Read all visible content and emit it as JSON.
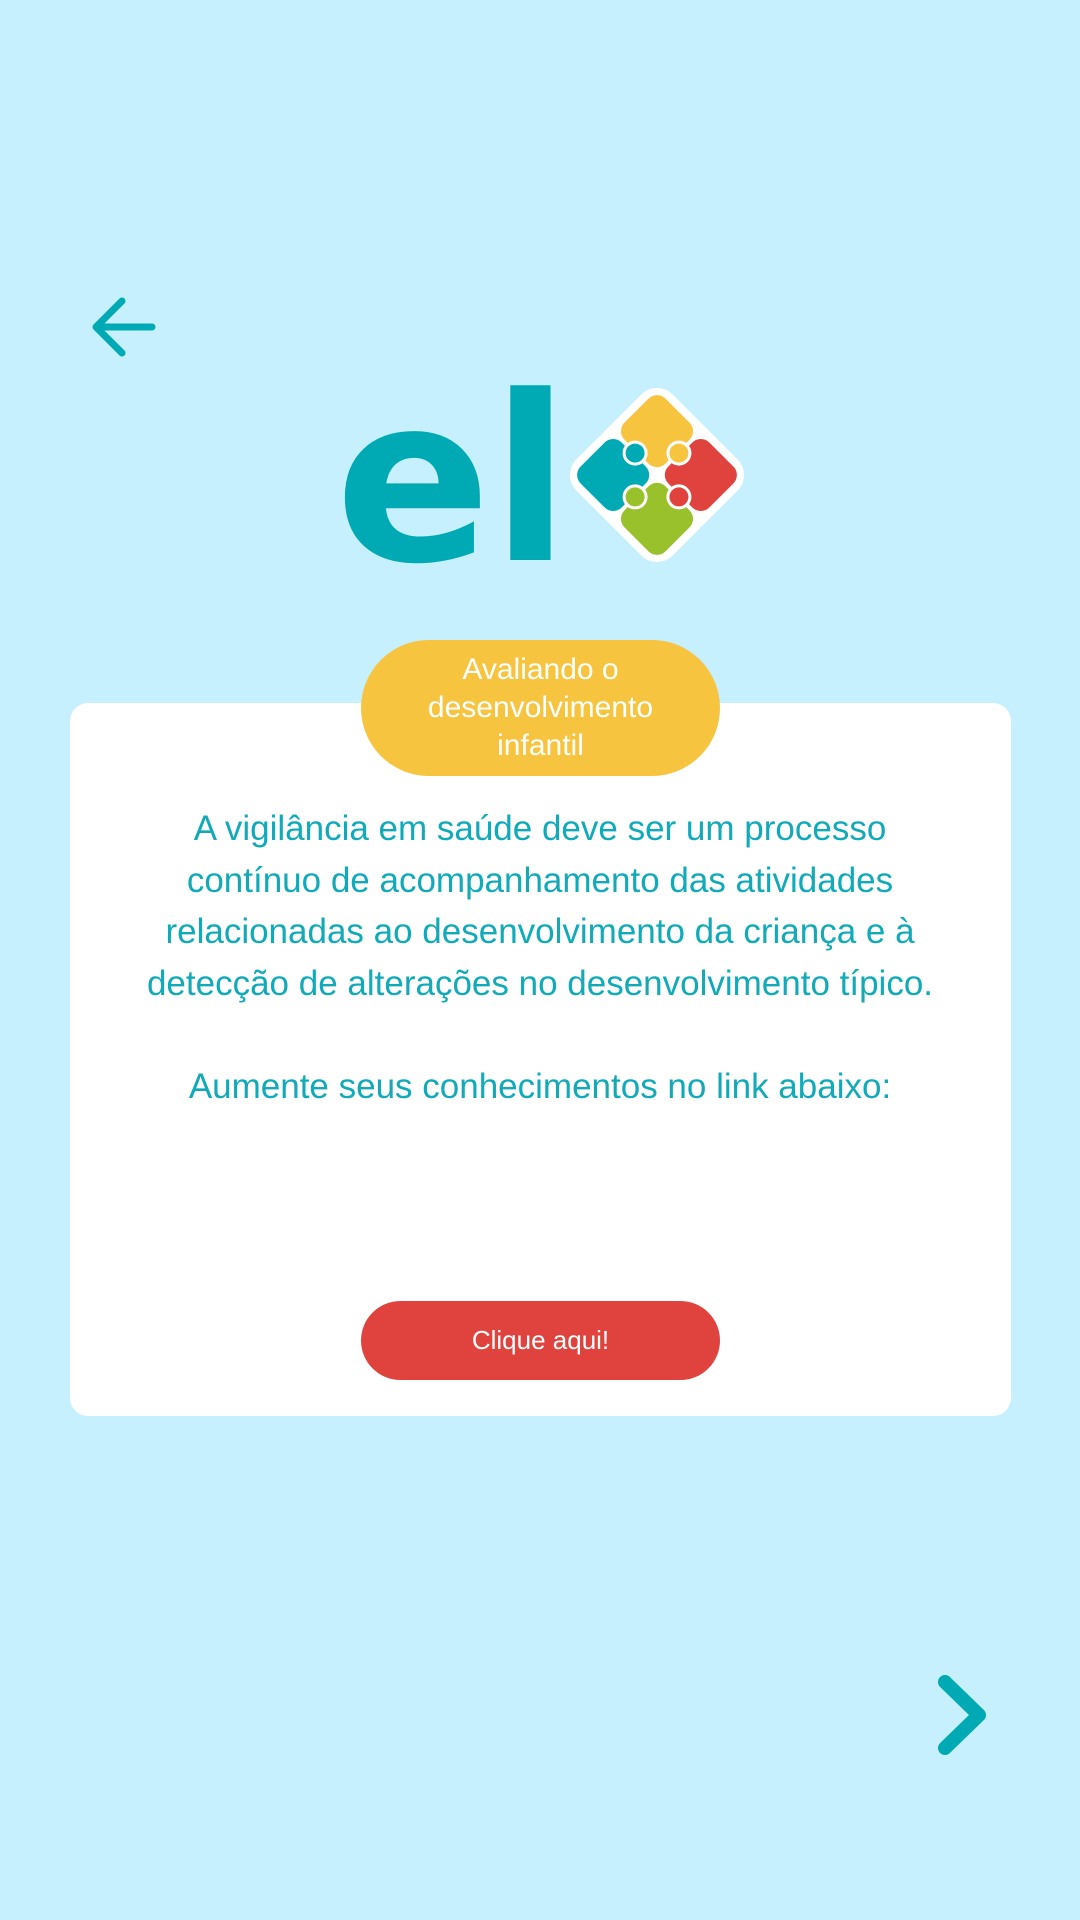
{
  "icons": {
    "back": "arrow-left-icon",
    "next": "chevron-right-icon",
    "logo_puzzle": "puzzle-icon"
  },
  "logo": {
    "text": "el"
  },
  "badge": {
    "text": "Avaliando o desenvolvimento infantil"
  },
  "content": {
    "paragraph": "A vigilância em saúde deve ser um processo contínuo de acompanhamento das atividades relacionadas ao desenvolvimento da criança e à detecção de alterações no desenvolvimento típico.",
    "cta_intro": "Aumente seus conhecimentos no link abaixo:"
  },
  "button": {
    "label": "Clique aqui!"
  },
  "colors": {
    "background": "#c6f0fd",
    "teal": "#00aab4",
    "yellow": "#f6c43f",
    "red": "#e0433d",
    "green": "#98c12c",
    "card": "#ffffff"
  }
}
